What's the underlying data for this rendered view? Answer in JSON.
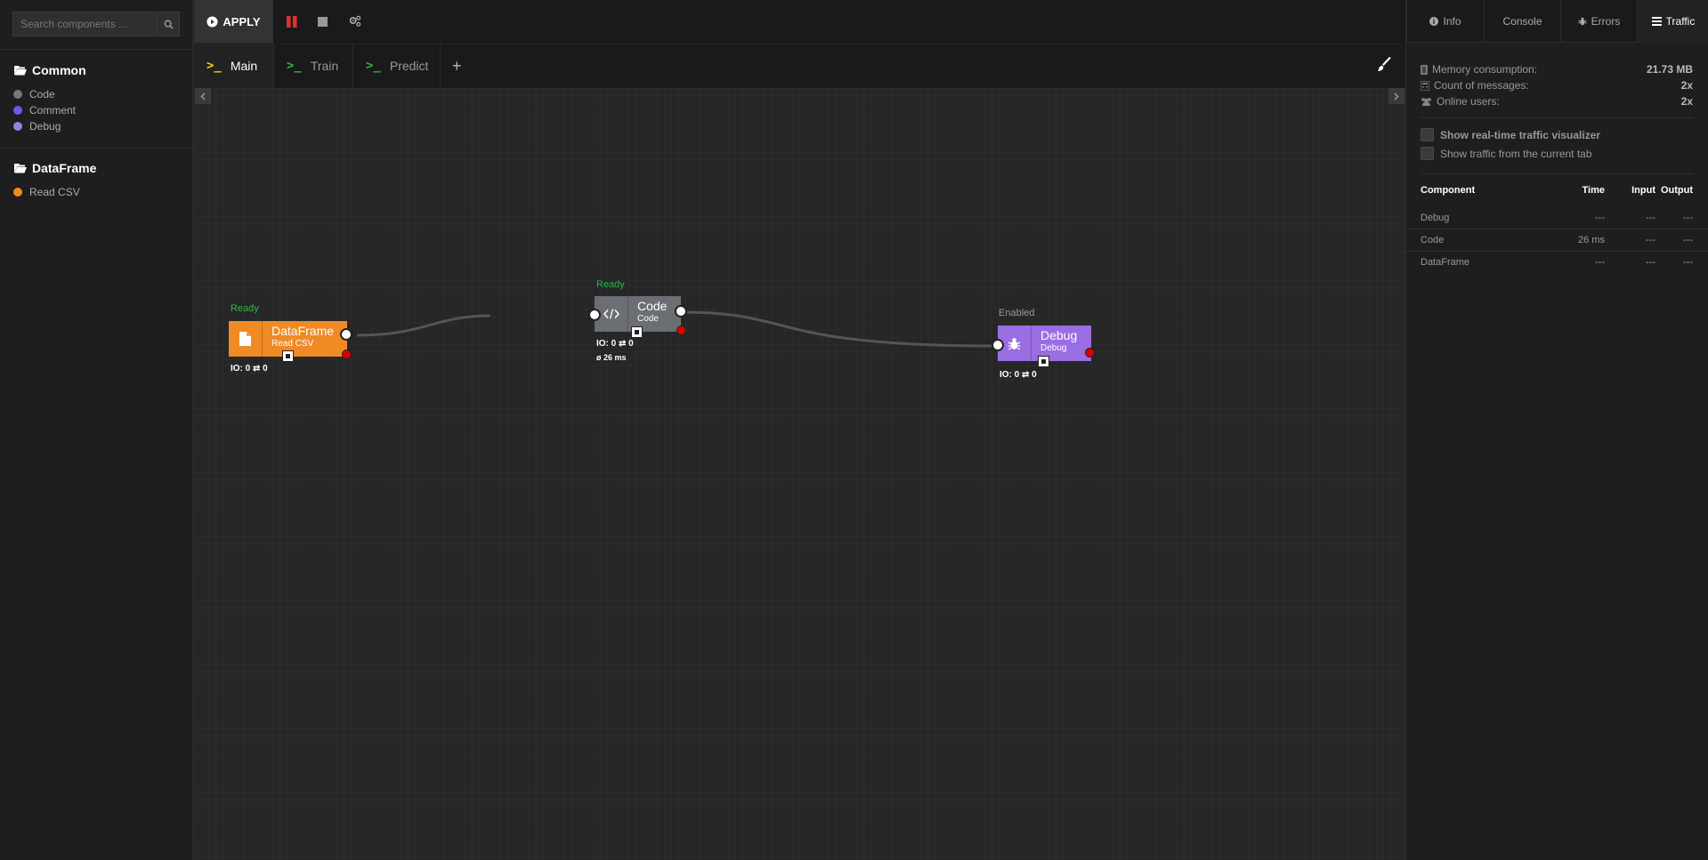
{
  "sidebar": {
    "search_placeholder": "Search components ...",
    "groups": [
      {
        "title": "Common",
        "items": [
          {
            "label": "Code",
            "color": "#777777"
          },
          {
            "label": "Comment",
            "color": "#6b5ce7"
          },
          {
            "label": "Debug",
            "color": "#9b7fe6"
          }
        ]
      },
      {
        "title": "DataFrame",
        "items": [
          {
            "label": "Read CSV",
            "color": "#f08a24"
          }
        ]
      }
    ]
  },
  "toolbar": {
    "apply_label": "APPLY",
    "pause_icon": "pause-icon",
    "stop_icon": "stop-icon",
    "settings_icon": "cogs-icon"
  },
  "flow_tabs": [
    {
      "label": "Main",
      "prompt": ">_",
      "prompt_color": "#f5d400",
      "active": true
    },
    {
      "label": "Train",
      "prompt": ">_",
      "prompt_color": "#2db34a",
      "active": false
    },
    {
      "label": "Predict",
      "prompt": ">_",
      "prompt_color": "#2db34a",
      "active": false
    }
  ],
  "add_tab_label": "+",
  "right_panel": {
    "tabs": [
      {
        "label": "Info",
        "icon": "info-icon"
      },
      {
        "label": "Console",
        "icon": ""
      },
      {
        "label": "Errors",
        "icon": "bug-icon"
      },
      {
        "label": "Traffic",
        "icon": "traffic-icon"
      }
    ],
    "active_tab": "Traffic",
    "stats": [
      {
        "label": "Memory consumption:",
        "value": "21.73 MB",
        "icon": "memory-icon"
      },
      {
        "label": "Count of messages:",
        "value": "2x",
        "icon": "calculator-icon"
      },
      {
        "label": "Online users:",
        "value": "2x",
        "icon": "users-icon"
      }
    ],
    "options": [
      {
        "label": "Show real-time traffic visualizer",
        "checked": false
      },
      {
        "label": "Show traffic from the current tab",
        "checked": false
      }
    ],
    "table": {
      "headers": [
        "Component",
        "Time",
        "Input",
        "Output"
      ],
      "rows": [
        [
          "Debug",
          "---",
          "---",
          "---"
        ],
        [
          "Code",
          "26 ms",
          "---",
          "---"
        ],
        [
          "DataFrame",
          "---",
          "---",
          "---"
        ]
      ]
    }
  },
  "nodes": [
    {
      "id": "dataframe",
      "status": "Ready",
      "status_color": "#2db34a",
      "title": "DataFrame",
      "subtitle": "Read CSV",
      "color": "#f08a24",
      "icon": "file-icon",
      "io": "IO: 0 ⇄ 0",
      "time": ""
    },
    {
      "id": "code",
      "status": "Ready",
      "status_color": "#2db34a",
      "title": "Code",
      "subtitle": "Code",
      "color": "#6b6e73",
      "icon": "code-icon",
      "io": "IO: 0 ⇄ 0",
      "time": "ø 26 ms"
    },
    {
      "id": "debug",
      "status": "Enabled",
      "status_color": "#999999",
      "title": "Debug",
      "subtitle": "Debug",
      "color": "#9b6de3",
      "icon": "bug-icon",
      "io": "IO: 0 ⇄ 0",
      "time": ""
    }
  ],
  "colors": {
    "accent_ready": "#2db34a",
    "error_port": "#dd0000",
    "pause_red": "#e0312f"
  }
}
